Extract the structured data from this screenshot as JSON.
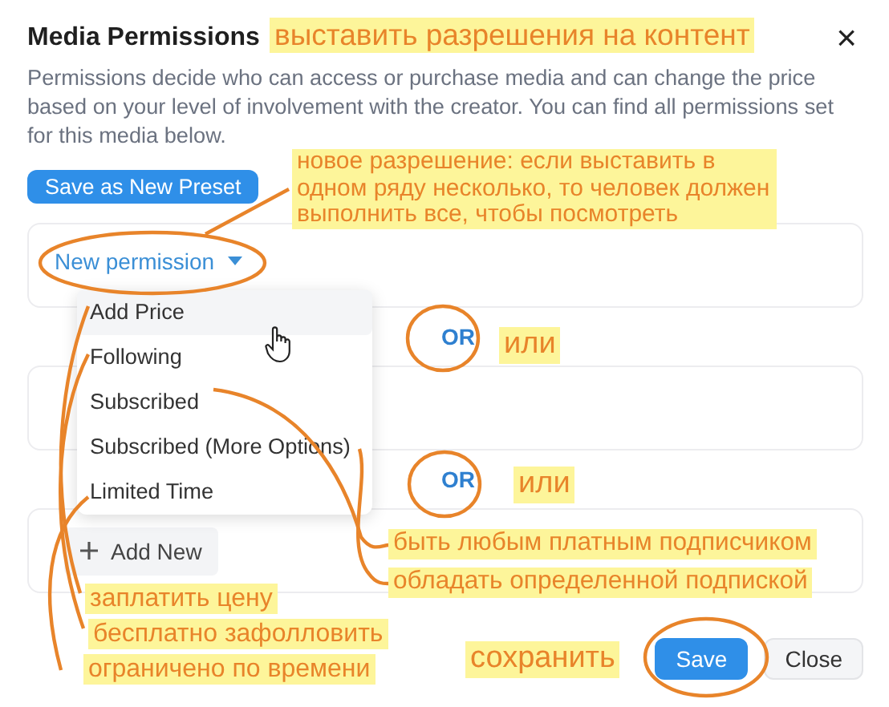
{
  "dialog": {
    "title": "Media Permissions",
    "close": "×",
    "description": "Permissions decide who can access or purchase media and can change the price based on your level of involvement with the creator. You can find all permissions set for this media below.",
    "preset_button": "Save as New Preset",
    "permissions": [
      {
        "kind": "dropdown",
        "label": "New permission",
        "expanded": true,
        "separator": "OR"
      },
      {
        "kind": "empty",
        "separator": "OR"
      },
      {
        "kind": "add",
        "label": "Add New"
      }
    ],
    "menu": [
      {
        "label": "Add Price",
        "highlighted": true
      },
      {
        "label": "Following",
        "highlighted": false
      },
      {
        "label": "Subscribed",
        "highlighted": false
      },
      {
        "label": "Subscribed (More Options)",
        "highlighted": false
      },
      {
        "label": "Limited Time",
        "highlighted": false
      }
    ],
    "buttons": [
      {
        "label": "Save",
        "kind": "primary"
      },
      {
        "label": "Close",
        "kind": "secondary"
      }
    ]
  },
  "annotations": [
    "выставить разрешения на контент",
    "новое разрешение: если выставить в одном ряду несколько, то человек должен выполнить все, чтобы посмотреть",
    "или",
    "или",
    "быть любым платным подписчиком",
    "обладать определенной подпиской",
    "заплатить цену",
    "бесплатно зафолловить",
    "ограничено по времени",
    "сохранить"
  ]
}
